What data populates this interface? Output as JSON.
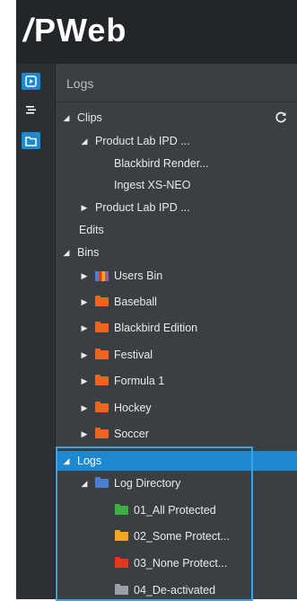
{
  "app": {
    "logo_text": "PWeb",
    "logo_mark": "/"
  },
  "panel": {
    "title": "Logs"
  },
  "rail": {
    "icons": [
      "play-icon",
      "list-icon",
      "folder-icon"
    ]
  },
  "tree": {
    "clips": "Clips",
    "product_lab_1": "Product Lab IPD ...",
    "blackbird_render": "Blackbird Render...",
    "ingest_xs_neo": "Ingest XS-NEO",
    "product_lab_2": "Product Lab IPD ...",
    "edits": "Edits",
    "bins": "Bins",
    "users_bin": "Users Bin",
    "baseball": "Baseball",
    "blackbird_edition": "Blackbird Edition",
    "festival": "Festival",
    "formula1": "Formula 1",
    "hockey": "Hockey",
    "soccer": "Soccer",
    "logs": "Logs",
    "log_directory": "Log Directory",
    "all_protected": "01_All Protected",
    "some_protect": "02_Some Protect...",
    "none_protect": "03_None Protect...",
    "deactivated": "04_De-activated"
  },
  "colors": {
    "accent": "#1e88d0",
    "bin_folder": "#f0641e",
    "log_dir_folder": "#4a7fd4",
    "green": "#3cb043",
    "orange": "#f5a623",
    "red": "#e03a1e",
    "grey": "#9aa0a6"
  }
}
